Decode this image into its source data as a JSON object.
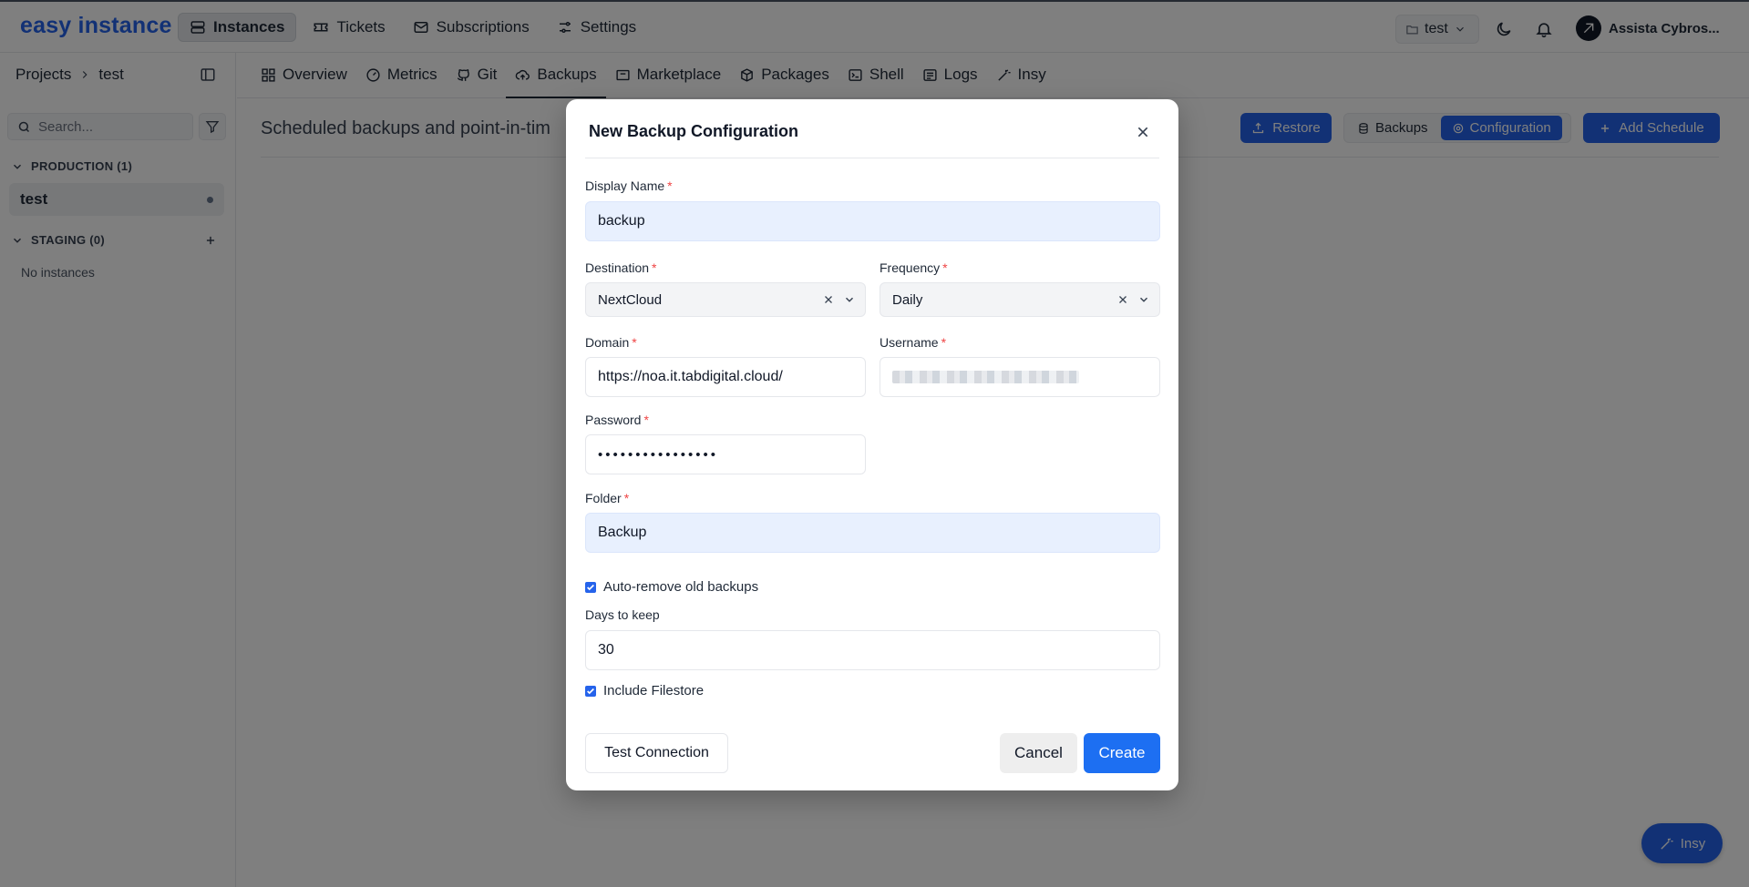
{
  "app": {
    "logo": "easy instance"
  },
  "topnav": [
    {
      "label": "Instances",
      "icon": "server-icon",
      "active": true
    },
    {
      "label": "Tickets",
      "icon": "ticket-icon",
      "active": false
    },
    {
      "label": "Subscriptions",
      "icon": "mail-icon",
      "active": false
    },
    {
      "label": "Settings",
      "icon": "sliders-icon",
      "active": false
    }
  ],
  "project_select": {
    "label": "test"
  },
  "user": {
    "name": "Assista Cybros..."
  },
  "sidebar": {
    "breadcrumb_root": "Projects",
    "breadcrumb_current": "test",
    "search_placeholder": "Search...",
    "production_group": "PRODUCTION (1)",
    "production_item": "test",
    "staging_group": "STAGING (0)",
    "staging_empty": "No instances"
  },
  "tabs": [
    {
      "label": "Overview",
      "icon": "grid-icon"
    },
    {
      "label": "Metrics",
      "icon": "gauge-icon"
    },
    {
      "label": "Git",
      "icon": "github-icon"
    },
    {
      "label": "Backups",
      "icon": "cloud-upload-icon",
      "active": true
    },
    {
      "label": "Marketplace",
      "icon": "store-icon"
    },
    {
      "label": "Packages",
      "icon": "package-icon"
    },
    {
      "label": "Shell",
      "icon": "terminal-icon"
    },
    {
      "label": "Logs",
      "icon": "list-icon"
    },
    {
      "label": "Insy",
      "icon": "wand-icon"
    }
  ],
  "page": {
    "description": "Scheduled backups and point-in-tim",
    "restore_label": "Restore",
    "seg_backups": "Backups",
    "seg_configuration": "Configuration",
    "add_schedule_label": "Add Schedule",
    "insy_label": "Insy"
  },
  "modal": {
    "title": "New Backup Configuration",
    "display_name_label": "Display Name",
    "display_name_value": "backup",
    "destination_label": "Destination",
    "destination_value": "NextCloud",
    "frequency_label": "Frequency",
    "frequency_value": "Daily",
    "domain_label": "Domain",
    "domain_value": "https://noa.it.tabdigital.cloud/",
    "username_label": "Username",
    "password_label": "Password",
    "password_value": "••••••••••••••••",
    "folder_label": "Folder",
    "folder_value": "Backup",
    "auto_remove_label": "Auto-remove old backups",
    "days_label": "Days to keep",
    "days_value": "30",
    "include_filestore_label": "Include Filestore",
    "test_connection_label": "Test Connection",
    "cancel_label": "Cancel",
    "create_label": "Create",
    "required_mark": "*"
  }
}
